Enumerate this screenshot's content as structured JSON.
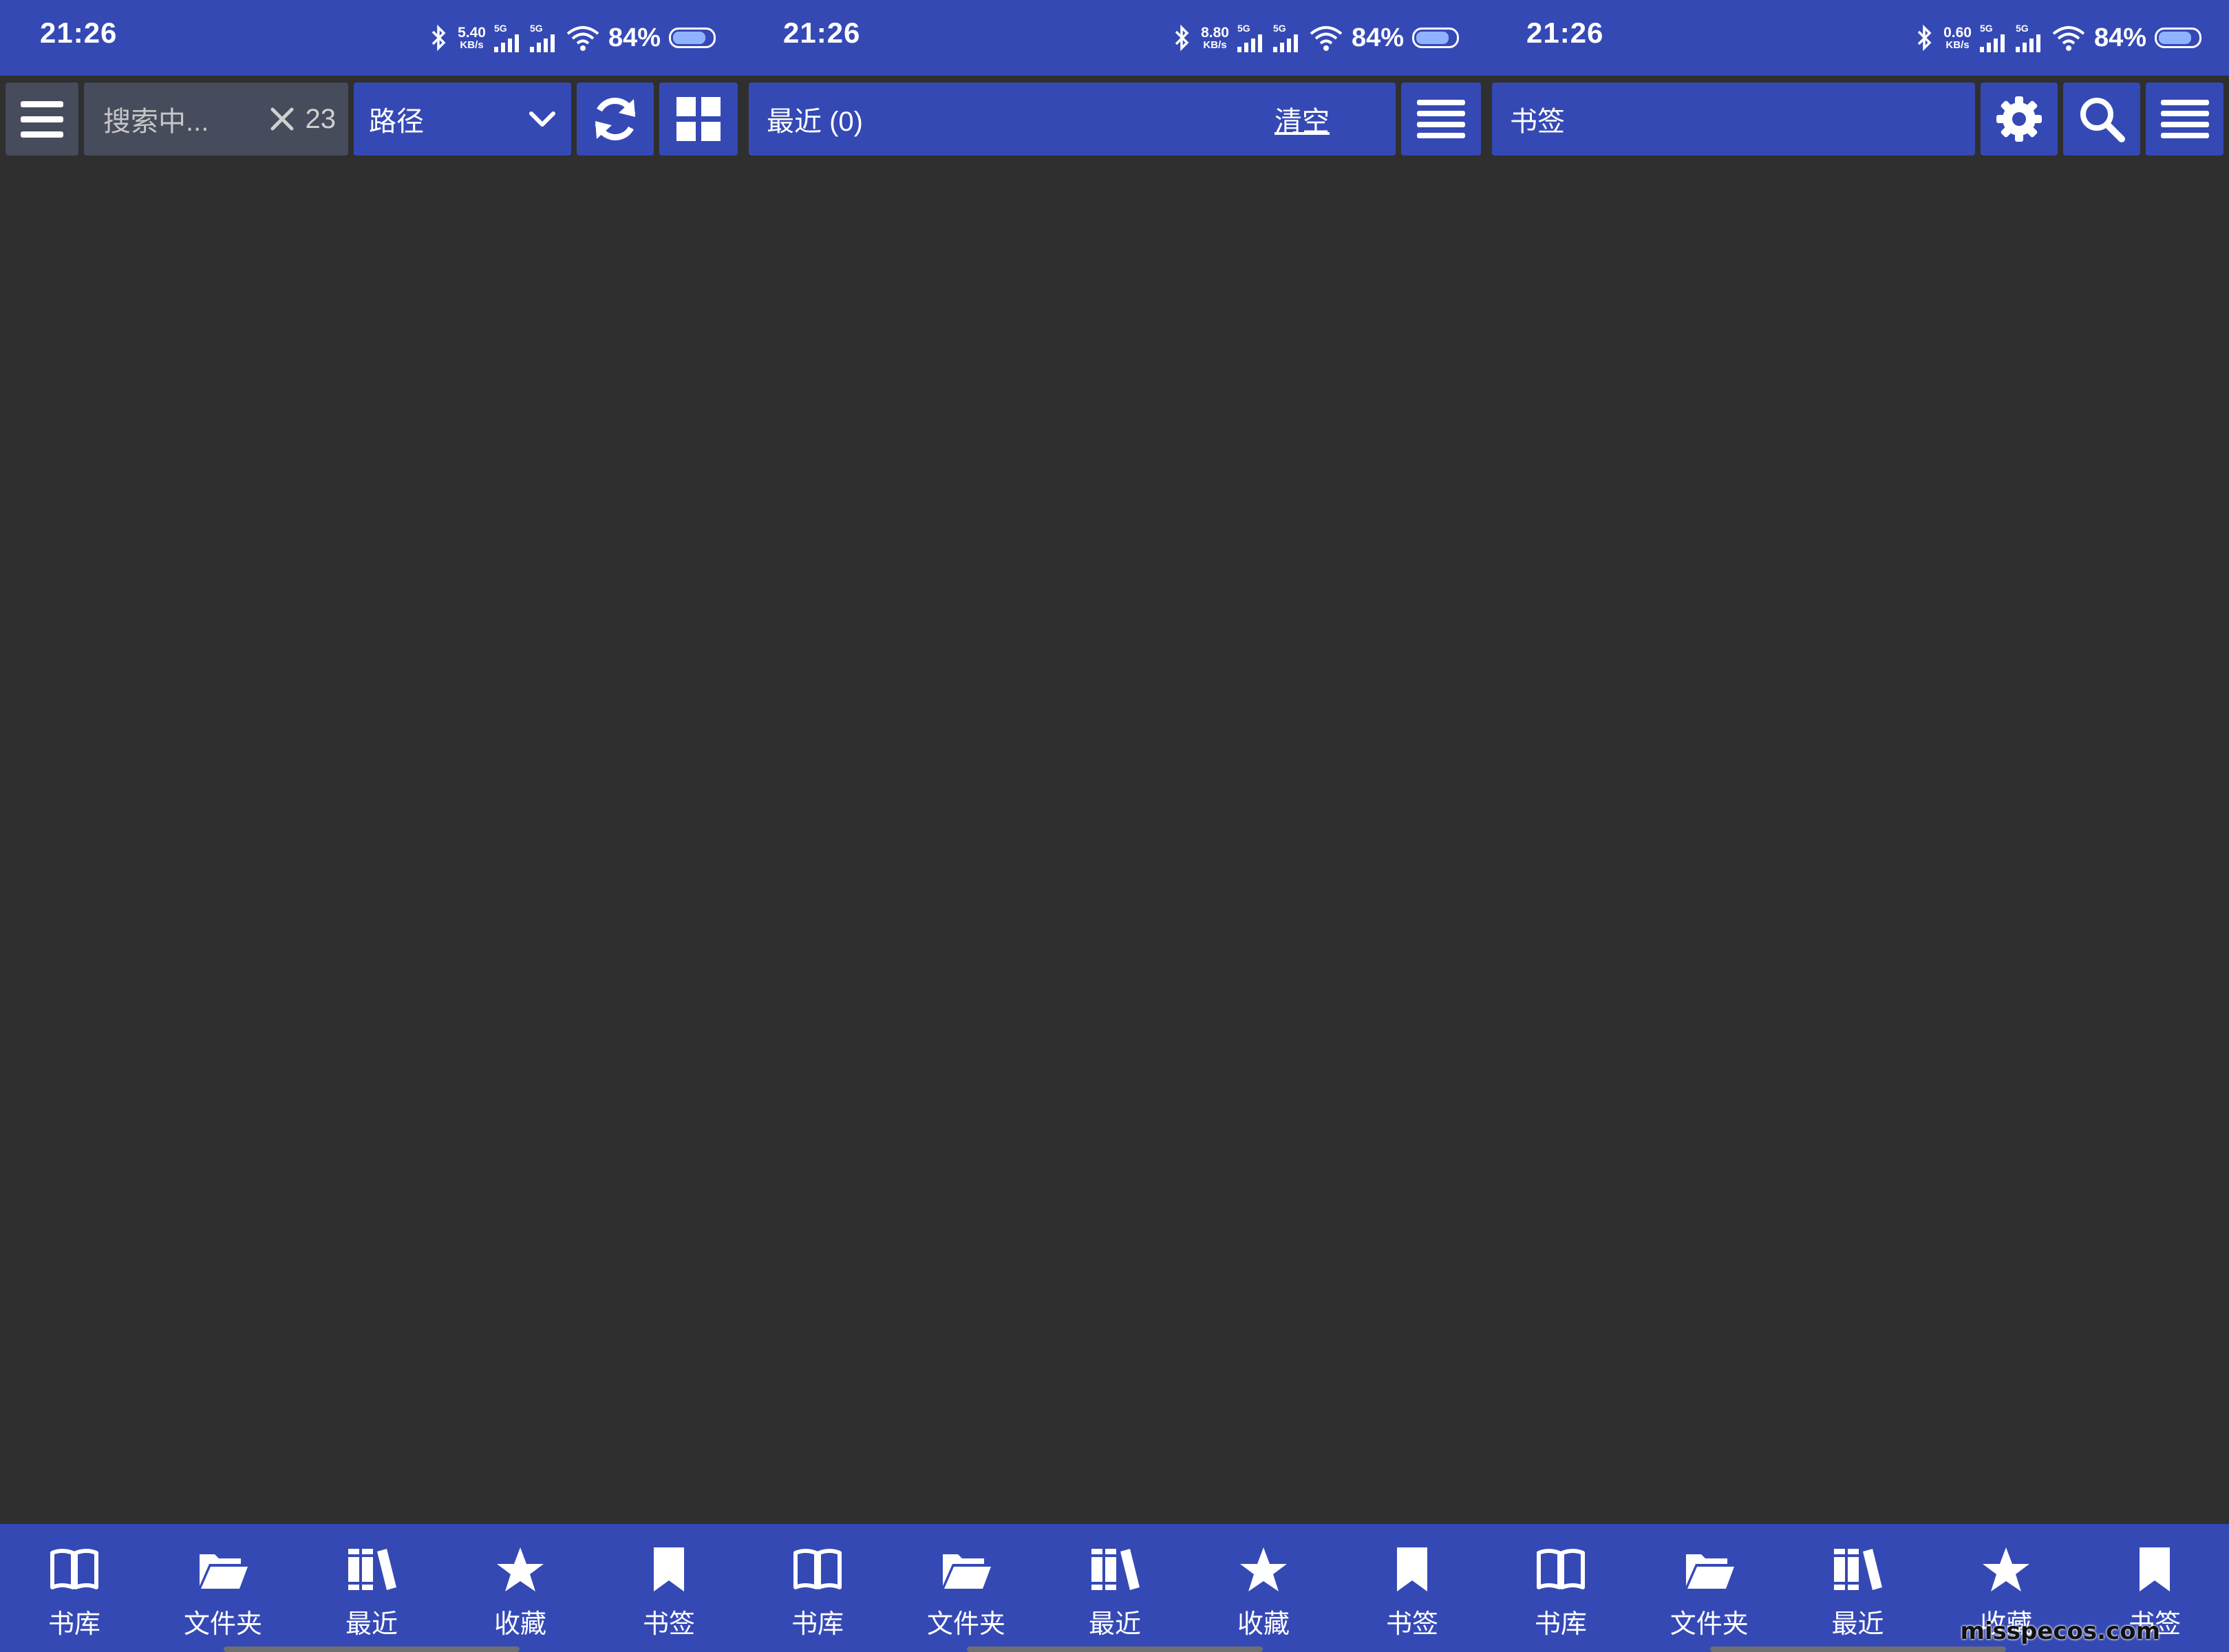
{
  "status_bars": [
    {
      "time": "21:26",
      "speed": "5.40",
      "speed_unit": "KB/s",
      "sig1": "5G",
      "sig2": "5G",
      "battery": "84%"
    },
    {
      "time": "21:26",
      "speed": "8.80",
      "speed_unit": "KB/s",
      "sig1": "5G",
      "sig2": "5G",
      "battery": "84%"
    },
    {
      "time": "21:26",
      "speed": "0.60",
      "speed_unit": "KB/s",
      "sig1": "5G",
      "sig2": "5G",
      "battery": "84%"
    }
  ],
  "library_toolbar": {
    "search_placeholder": "搜索中...",
    "result_count": "23",
    "path_label": "路径"
  },
  "recent_toolbar": {
    "title": "最近 (0)",
    "clear_label": "清空"
  },
  "bookmarks_toolbar": {
    "title": "书签"
  },
  "bottom_nav": {
    "items": [
      {
        "label": "书库",
        "icon": "open-book-icon"
      },
      {
        "label": "文件夹",
        "icon": "folder-open-icon"
      },
      {
        "label": "最近",
        "icon": "books-icon"
      },
      {
        "label": "收藏",
        "icon": "star-icon"
      },
      {
        "label": "书签",
        "icon": "bookmark-icon"
      }
    ]
  },
  "watermark": "misspecos.com",
  "colors": {
    "accent": "#3549b5",
    "background": "#2f2f2f",
    "search_bg": "#474c5c"
  }
}
